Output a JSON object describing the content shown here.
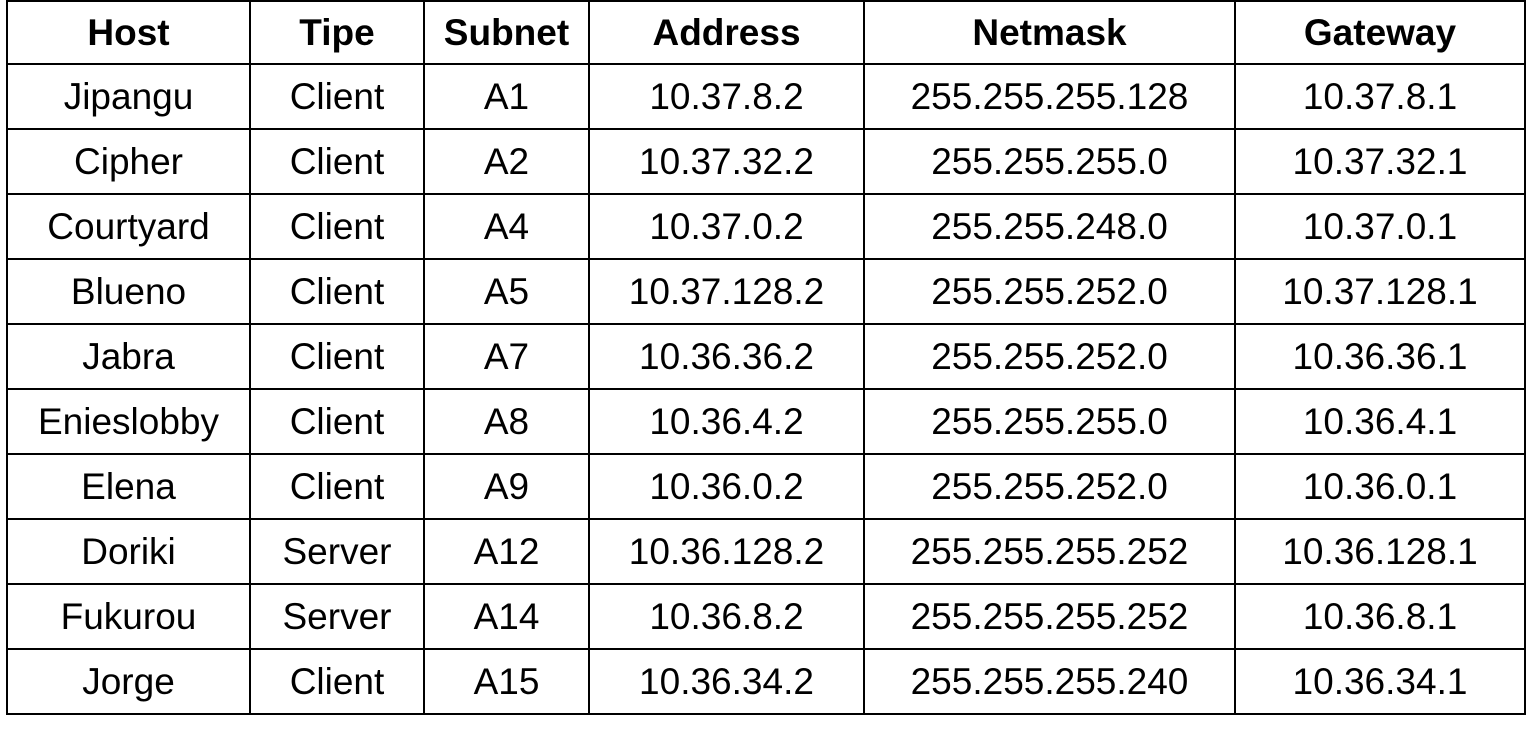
{
  "table": {
    "headers": [
      "Host",
      "Tipe",
      "Subnet",
      "Address",
      "Netmask",
      "Gateway"
    ],
    "rows": [
      [
        "Jipangu",
        "Client",
        "A1",
        "10.37.8.2",
        "255.255.255.128",
        "10.37.8.1"
      ],
      [
        "Cipher",
        "Client",
        "A2",
        "10.37.32.2",
        "255.255.255.0",
        "10.37.32.1"
      ],
      [
        "Courtyard",
        "Client",
        "A4",
        "10.37.0.2",
        "255.255.248.0",
        "10.37.0.1"
      ],
      [
        "Blueno",
        "Client",
        "A5",
        "10.37.128.2",
        "255.255.252.0",
        "10.37.128.1"
      ],
      [
        "Jabra",
        "Client",
        "A7",
        "10.36.36.2",
        "255.255.252.0",
        "10.36.36.1"
      ],
      [
        "Enieslobby",
        "Client",
        "A8",
        "10.36.4.2",
        "255.255.255.0",
        "10.36.4.1"
      ],
      [
        "Elena",
        "Client",
        "A9",
        "10.36.0.2",
        "255.255.252.0",
        "10.36.0.1"
      ],
      [
        "Doriki",
        "Server",
        "A12",
        "10.36.128.2",
        "255.255.255.252",
        "10.36.128.1"
      ],
      [
        "Fukurou",
        "Server",
        "A14",
        "10.36.8.2",
        "255.255.255.252",
        "10.36.8.1"
      ],
      [
        "Jorge",
        "Client",
        "A15",
        "10.36.34.2",
        "255.255.255.240",
        "10.36.34.1"
      ]
    ]
  }
}
